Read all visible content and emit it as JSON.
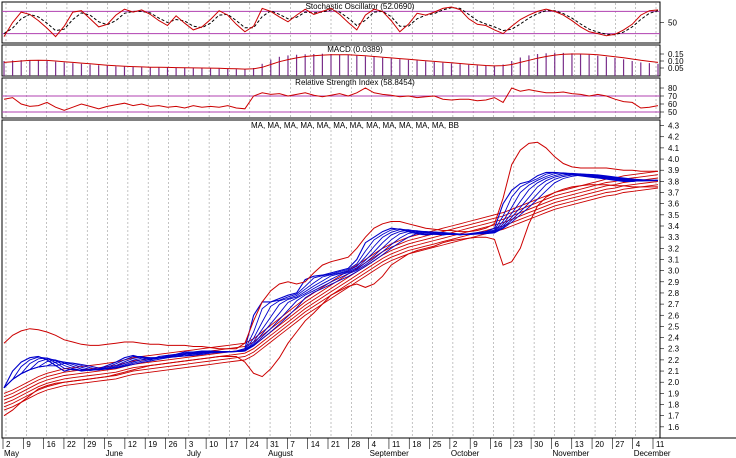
{
  "chart_data": [
    {
      "type": "line",
      "title": "Stochastic Oscillator (52.0690)",
      "ylim": [
        0,
        100
      ],
      "yticks": [
        "50"
      ],
      "reference_lines": [
        80,
        20
      ],
      "colors": {
        "k": "#cc0000",
        "d": "#000000",
        "ref": "#b040b0"
      },
      "series": [
        {
          "name": "%K",
          "values": [
            12,
            50,
            78,
            72,
            55,
            35,
            12,
            40,
            78,
            82,
            60,
            38,
            45,
            70,
            86,
            78,
            84,
            72,
            55,
            42,
            68,
            48,
            30,
            38,
            58,
            82,
            70,
            45,
            25,
            40,
            88,
            80,
            65,
            52,
            70,
            86,
            72,
            80,
            88,
            72,
            50,
            30,
            70,
            86,
            80,
            55,
            25,
            45,
            75,
            70,
            78,
            88,
            92,
            85,
            60,
            45,
            42,
            30,
            20,
            40,
            58,
            70,
            80,
            86,
            80,
            70,
            55,
            38,
            25,
            20,
            14,
            18,
            30,
            45,
            70,
            82,
            84
          ]
        },
        {
          "name": "%D",
          "values": [
            20,
            35,
            60,
            72,
            65,
            48,
            28,
            32,
            58,
            76,
            70,
            52,
            44,
            55,
            75,
            80,
            80,
            76,
            62,
            50,
            58,
            54,
            40,
            36,
            48,
            70,
            72,
            55,
            36,
            36,
            66,
            82,
            72,
            60,
            64,
            78,
            76,
            78,
            84,
            78,
            62,
            42,
            56,
            78,
            80,
            66,
            40,
            40,
            60,
            70,
            74,
            84,
            90,
            88,
            72,
            55,
            46,
            38,
            28,
            32,
            46,
            62,
            74,
            82,
            82,
            74,
            62,
            46,
            32,
            24,
            18,
            17,
            24,
            38,
            58,
            75,
            82
          ]
        }
      ]
    },
    {
      "type": "bar",
      "title": "MACD (0.0389)",
      "ylim": [
        0,
        0.2
      ],
      "yticks": [
        "0.15",
        "0.10",
        "0.05"
      ],
      "colors": {
        "bars": "#7a2f8a",
        "signal": "#cc0000"
      },
      "series": [
        {
          "name": "MACD",
          "values": [
            0.1,
            0.104,
            0.106,
            0.107,
            0.105,
            0.1,
            0.095,
            0.09,
            0.085,
            0.08,
            0.075,
            0.07,
            0.066,
            0.062,
            0.06,
            0.058,
            0.056,
            0.055,
            0.054,
            0.053,
            0.052,
            0.051,
            0.05,
            0.049,
            0.048,
            0.046,
            0.044,
            0.042,
            0.04,
            0.05,
            0.08,
            0.11,
            0.13,
            0.14,
            0.145,
            0.148,
            0.15,
            0.152,
            0.15,
            0.147,
            0.143,
            0.138,
            0.133,
            0.128,
            0.123,
            0.118,
            0.113,
            0.108,
            0.103,
            0.098,
            0.093,
            0.088,
            0.083,
            0.078,
            0.073,
            0.068,
            0.065,
            0.063,
            0.075,
            0.1,
            0.125,
            0.14,
            0.15,
            0.155,
            0.16,
            0.158,
            0.155,
            0.15,
            0.145,
            0.138,
            0.13,
            0.122,
            0.112,
            0.1,
            0.09,
            0.085,
            0.08
          ]
        },
        {
          "name": "Signal",
          "values": [
            0.09,
            0.095,
            0.1,
            0.104,
            0.105,
            0.104,
            0.1,
            0.095,
            0.09,
            0.085,
            0.08,
            0.075,
            0.07,
            0.066,
            0.063,
            0.06,
            0.058,
            0.056,
            0.055,
            0.054,
            0.053,
            0.052,
            0.051,
            0.05,
            0.049,
            0.048,
            0.046,
            0.044,
            0.042,
            0.044,
            0.055,
            0.075,
            0.095,
            0.11,
            0.122,
            0.132,
            0.138,
            0.142,
            0.144,
            0.145,
            0.144,
            0.141,
            0.137,
            0.132,
            0.127,
            0.122,
            0.117,
            0.112,
            0.107,
            0.102,
            0.097,
            0.092,
            0.087,
            0.082,
            0.077,
            0.072,
            0.068,
            0.065,
            0.067,
            0.075,
            0.09,
            0.105,
            0.12,
            0.132,
            0.142,
            0.148,
            0.15,
            0.15,
            0.148,
            0.144,
            0.138,
            0.131,
            0.123,
            0.114,
            0.105,
            0.097,
            0.09
          ]
        }
      ]
    },
    {
      "type": "line",
      "title": "Relative Strength Index (58.8454)",
      "ylim": [
        45,
        90
      ],
      "yticks": [
        "80",
        "70",
        "60",
        "50"
      ],
      "reference_lines": [
        70,
        50
      ],
      "colors": {
        "line": "#cc0000",
        "ref": "#b040b0"
      },
      "series": [
        {
          "name": "RSI",
          "values": [
            66,
            68,
            60,
            57,
            58,
            62,
            56,
            52,
            56,
            60,
            57,
            54,
            57,
            59,
            61,
            58,
            60,
            57,
            58,
            56,
            57,
            55,
            58,
            56,
            57,
            56,
            58,
            55,
            54,
            70,
            74,
            72,
            73,
            70,
            72,
            74,
            71,
            69,
            71,
            73,
            70,
            74,
            80,
            74,
            72,
            71,
            69,
            70,
            68,
            69,
            70,
            66,
            65,
            66,
            66,
            64,
            65,
            68,
            62,
            80,
            76,
            78,
            76,
            74,
            74,
            75,
            73,
            72,
            70,
            72,
            70,
            66,
            63,
            62,
            55,
            56,
            58
          ]
        }
      ]
    },
    {
      "type": "line",
      "title": "MA, MA, MA, MA, MA, MA, MA, MA, MA, MA, MA, MA, BB",
      "ylim": [
        1.5,
        4.35
      ],
      "yticks": [
        "4.3",
        "4.2",
        "4.1",
        "4.0",
        "3.9",
        "3.8",
        "3.7",
        "3.6",
        "3.5",
        "3.4",
        "3.3",
        "3.2",
        "3.1",
        "3.0",
        "2.9",
        "2.8",
        "2.7",
        "2.6",
        "2.5",
        "2.4",
        "2.3",
        "2.2",
        "2.1",
        "2.0",
        "1.9",
        "1.8",
        "1.7",
        "1.6"
      ],
      "x_day_labels": [
        "2",
        "9",
        "16",
        "22",
        "29",
        "5",
        "12",
        "19",
        "26",
        "3",
        "10",
        "17",
        "24",
        "31",
        "7",
        "14",
        "21",
        "28",
        "4",
        "11",
        "18",
        "25",
        "2",
        "9",
        "16",
        "23",
        "30",
        "6",
        "13",
        "20",
        "27",
        "4",
        "11"
      ],
      "x_month_labels": [
        "May",
        "June",
        "July",
        "August",
        "September",
        "October",
        "November",
        "December"
      ],
      "colors": {
        "short_ma": "#0000cc",
        "long_ma": "#cc0000",
        "bands": "#cc0000"
      },
      "price": [
        1.95,
        2.1,
        2.18,
        2.22,
        2.23,
        2.2,
        2.15,
        2.1,
        2.12,
        2.1,
        2.11,
        2.12,
        2.15,
        2.18,
        2.22,
        2.24,
        2.22,
        2.2,
        2.23,
        2.24,
        2.25,
        2.27,
        2.27,
        2.28,
        2.28,
        2.27,
        2.27,
        2.28,
        2.3,
        2.6,
        2.72,
        2.72,
        2.75,
        2.78,
        2.8,
        2.92,
        2.95,
        2.96,
        2.98,
        3.0,
        3.02,
        3.1,
        3.25,
        3.3,
        3.35,
        3.38,
        3.37,
        3.35,
        3.33,
        3.32,
        3.33,
        3.32,
        3.33,
        3.32,
        3.33,
        3.34,
        3.35,
        3.38,
        3.6,
        3.72,
        3.78,
        3.8,
        3.85,
        3.88,
        3.88,
        3.87,
        3.86,
        3.85,
        3.84,
        3.83,
        3.82,
        3.81,
        3.8,
        3.8,
        3.81,
        3.81,
        3.81
      ],
      "short_ma_spreads": [
        0.025,
        0.05,
        0.075,
        0.1,
        0.125,
        0.15
      ],
      "long_ma_floor": [
        1.75,
        1.78,
        1.82,
        1.86,
        1.9,
        1.93,
        1.95,
        1.97,
        1.98,
        1.99,
        2.0,
        2.01,
        2.02,
        2.03,
        2.05,
        2.07,
        2.08,
        2.09,
        2.1,
        2.11,
        2.12,
        2.13,
        2.14,
        2.15,
        2.16,
        2.17,
        2.18,
        2.19,
        2.2,
        2.24,
        2.3,
        2.36,
        2.42,
        2.48,
        2.54,
        2.6,
        2.65,
        2.7,
        2.75,
        2.8,
        2.85,
        2.9,
        2.95,
        3.0,
        3.05,
        3.09,
        3.12,
        3.15,
        3.17,
        3.19,
        3.21,
        3.23,
        3.25,
        3.27,
        3.29,
        3.31,
        3.33,
        3.35,
        3.37,
        3.4,
        3.43,
        3.46,
        3.49,
        3.52,
        3.55,
        3.57,
        3.59,
        3.61,
        3.63,
        3.65,
        3.67,
        3.68,
        3.7,
        3.71,
        3.72,
        3.73,
        3.74
      ],
      "long_ma_offsets": [
        0.0,
        0.03,
        0.06,
        0.09,
        0.12,
        0.15
      ],
      "bb_upper": [
        2.35,
        2.42,
        2.46,
        2.48,
        2.47,
        2.45,
        2.42,
        2.38,
        2.36,
        2.34,
        2.33,
        2.33,
        2.34,
        2.35,
        2.36,
        2.36,
        2.35,
        2.34,
        2.34,
        2.33,
        2.33,
        2.33,
        2.32,
        2.32,
        2.31,
        2.3,
        2.3,
        2.3,
        2.35,
        2.55,
        2.72,
        2.82,
        2.88,
        2.9,
        2.88,
        2.9,
        2.98,
        3.05,
        3.08,
        3.1,
        3.12,
        3.2,
        3.3,
        3.38,
        3.42,
        3.44,
        3.44,
        3.42,
        3.4,
        3.38,
        3.37,
        3.36,
        3.36,
        3.35,
        3.35,
        3.36,
        3.38,
        3.42,
        3.65,
        3.95,
        4.08,
        4.14,
        4.15,
        4.1,
        4.02,
        3.96,
        3.93,
        3.92,
        3.92,
        3.92,
        3.92,
        3.91,
        3.9,
        3.9,
        3.89,
        3.89,
        3.89
      ],
      "bb_lower": [
        1.7,
        1.75,
        1.82,
        1.88,
        1.94,
        1.97,
        1.99,
        2.0,
        2.01,
        2.02,
        2.03,
        2.04,
        2.05,
        2.07,
        2.09,
        2.11,
        2.13,
        2.15,
        2.16,
        2.17,
        2.18,
        2.19,
        2.2,
        2.21,
        2.22,
        2.23,
        2.23,
        2.23,
        2.18,
        2.08,
        2.05,
        2.12,
        2.22,
        2.35,
        2.45,
        2.55,
        2.62,
        2.7,
        2.78,
        2.82,
        2.86,
        2.88,
        2.85,
        2.88,
        2.95,
        3.05,
        3.1,
        3.15,
        3.18,
        3.2,
        3.22,
        3.25,
        3.27,
        3.28,
        3.29,
        3.3,
        3.3,
        3.28,
        3.05,
        3.08,
        3.2,
        3.42,
        3.58,
        3.66,
        3.7,
        3.73,
        3.75,
        3.76,
        3.77,
        3.77,
        3.77,
        3.76,
        3.76,
        3.75,
        3.75,
        3.75,
        3.75
      ]
    }
  ]
}
